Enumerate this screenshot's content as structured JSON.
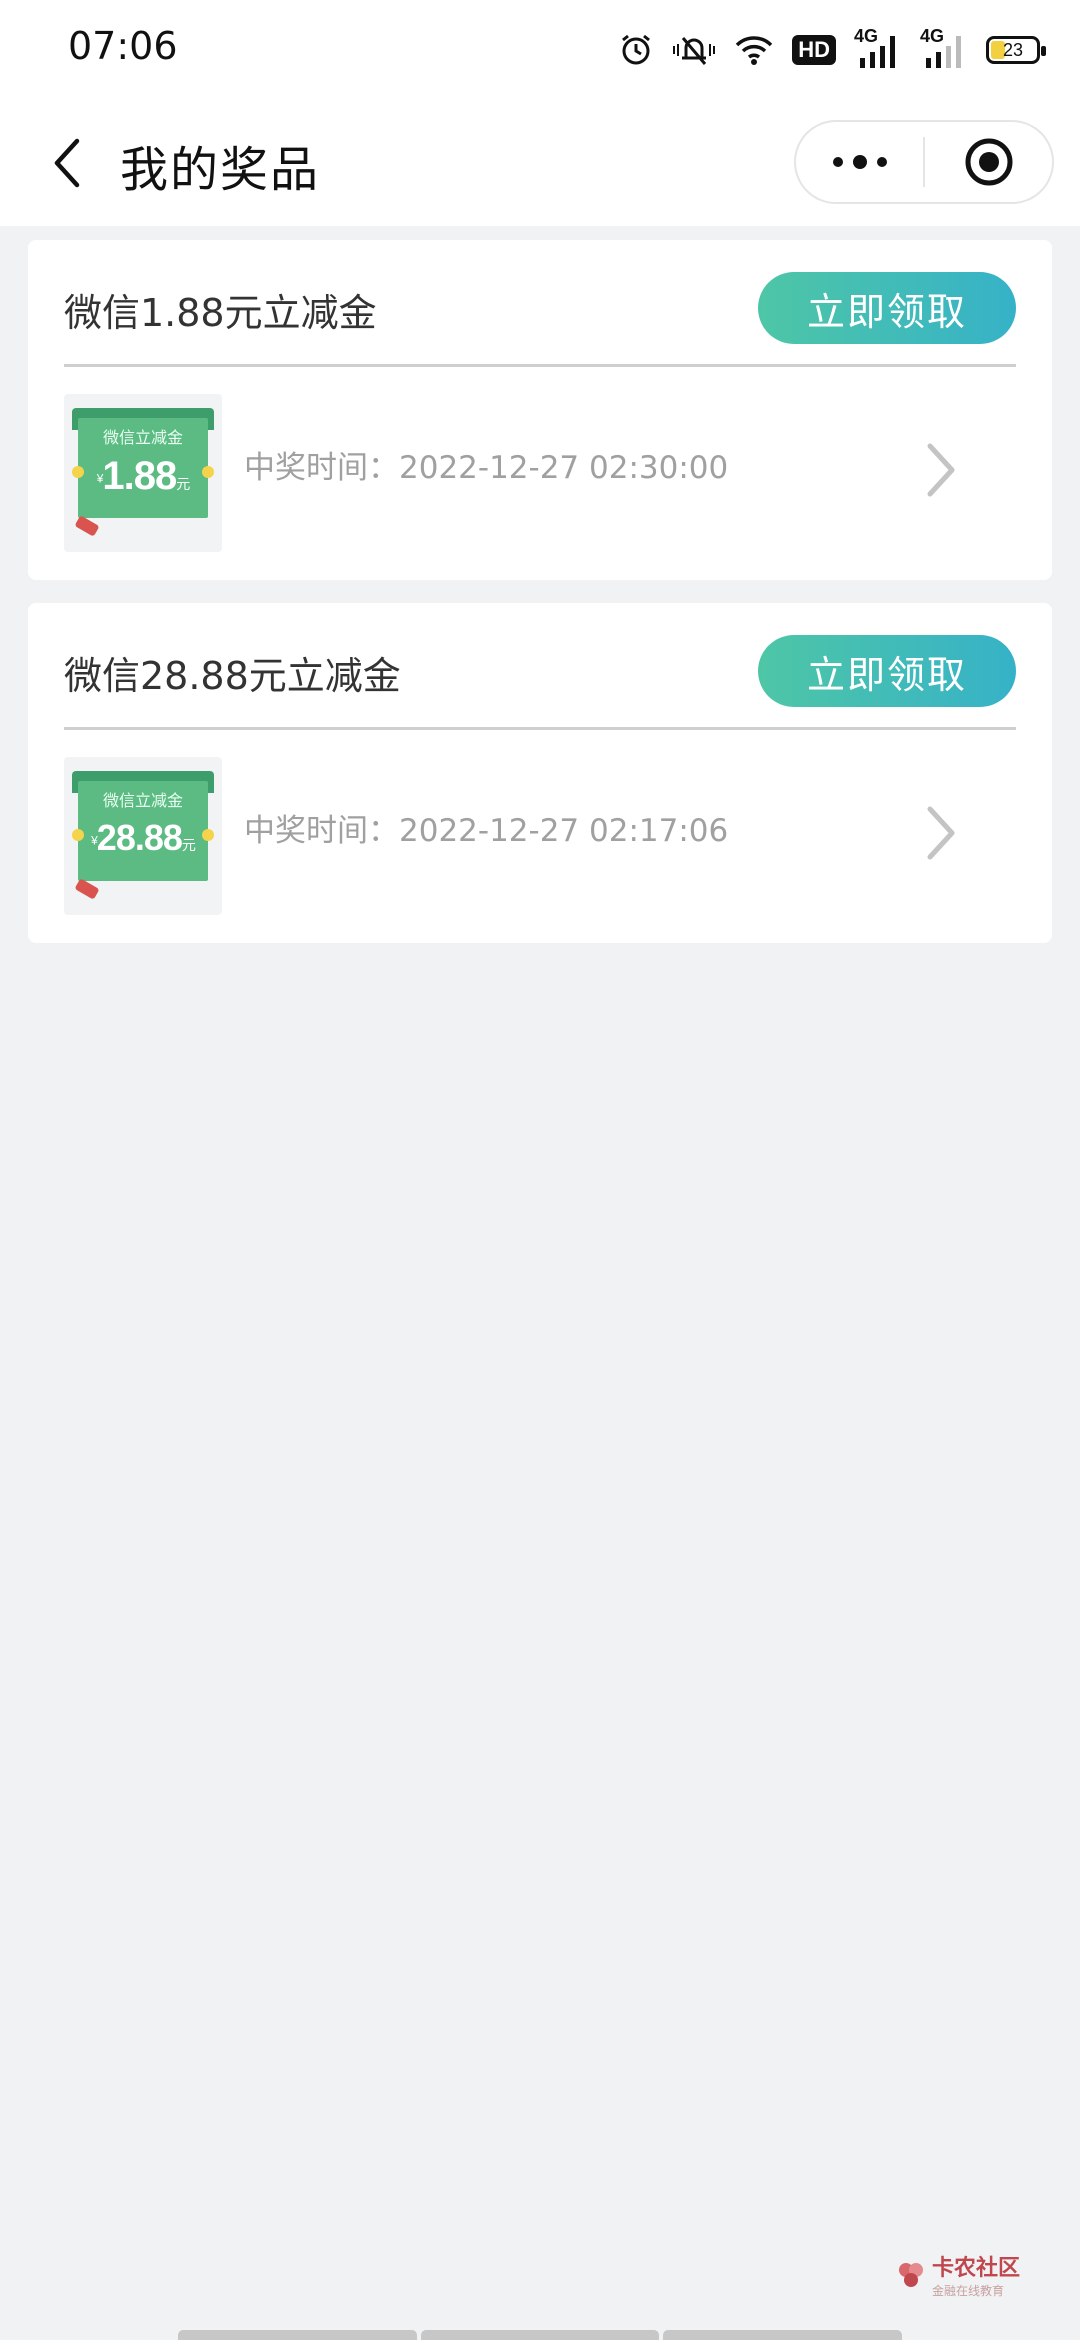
{
  "status_bar": {
    "time": "07:06",
    "hd_label": "HD",
    "network_labels": [
      "4G",
      "4G"
    ],
    "battery": "23",
    "icons": [
      "alarm-icon",
      "mute-icon",
      "wifi-icon",
      "hd-icon",
      "signal-4g-icon",
      "signal-4g-icon",
      "battery-icon"
    ]
  },
  "nav": {
    "title": "我的奖品",
    "back_icon": "back-arrow-icon",
    "more_icon": "more-dots-icon",
    "close_icon": "target-close-icon"
  },
  "prizes": [
    {
      "title": "微信1.88元立减金",
      "button": "立即领取",
      "coupon_label": "微信立减金",
      "coupon_amount": "1.88",
      "coupon_unit": "元",
      "coupon_currency": "¥",
      "win_time": "中奖时间：2022-12-27 02:30:00"
    },
    {
      "title": "微信28.88元立减金",
      "button": "立即领取",
      "coupon_label": "微信立减金",
      "coupon_amount": "28.88",
      "coupon_unit": "元",
      "coupon_currency": "¥",
      "win_time": "中奖时间：2022-12-27 02:17:06"
    }
  ],
  "watermark": {
    "title": "卡农社区",
    "subtitle": "金融在线教育"
  },
  "colors": {
    "button_gradient_start": "#4ec6a6",
    "button_gradient_end": "#36b2c8",
    "coupon_green": "#5bbb83",
    "background": "#f1f2f4"
  }
}
